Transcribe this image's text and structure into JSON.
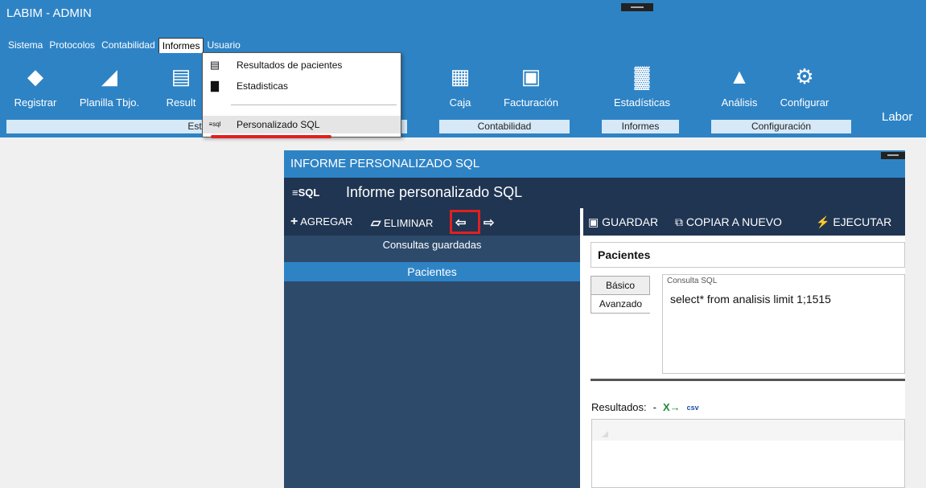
{
  "app": {
    "title": "LABIM - ADMIN",
    "right_label": "Labor"
  },
  "menu": [
    "Sistema",
    "Protocolos",
    "Contabilidad",
    "Informes",
    "Usuario"
  ],
  "toolbar": [
    {
      "label": "Registrar",
      "icon": "registrar-icon",
      "glyph": "◆"
    },
    {
      "label": "Planilla Tbjo.",
      "icon": "planilla-icon",
      "glyph": "◢"
    },
    {
      "label": "Result",
      "icon": "resultados-icon",
      "glyph": "▤"
    },
    {
      "label": "Caja",
      "icon": "caja-icon",
      "glyph": "▦"
    },
    {
      "label": "Facturación",
      "icon": "facturacion-icon",
      "glyph": "▣"
    },
    {
      "label": "Estadísticas",
      "icon": "estadisticas-icon",
      "glyph": "▓"
    },
    {
      "label": "Análisis",
      "icon": "analisis-icon",
      "glyph": "▲"
    },
    {
      "label": "Configurar",
      "icon": "configurar-icon",
      "glyph": "⚙"
    }
  ],
  "groups": [
    "Estudio -",
    "Contabilidad",
    "Informes",
    "Configuración"
  ],
  "dropdown": [
    {
      "label": "Resultados de pacientes",
      "icon": "document-icon",
      "glyph": "▤"
    },
    {
      "label": "Estadisticas",
      "icon": "bar-chart-icon",
      "glyph": "▇"
    },
    {
      "label": "Personalizado SQL",
      "icon": "sql-icon",
      "glyph": "≡sql"
    }
  ],
  "window": {
    "title": "INFORME PERSONALIZADO SQL",
    "heading_icon": "≡SQL",
    "heading": "Informe personalizado SQL",
    "left_toolbar": {
      "add": "AGREGAR",
      "delete": "ELIMINAR",
      "import_glyph": "⇦",
      "export_glyph": "⇨"
    },
    "saved_title": "Consultas guardadas",
    "saved_items": [
      "Pacientes"
    ],
    "right_toolbar": {
      "save": "GUARDAR",
      "copy": "COPIAR A NUEVO",
      "run": "EJECUTAR"
    },
    "query_name": "Pacientes",
    "tabs": [
      "Básico",
      "Avanzado"
    ],
    "sql_caption": "Consulta SQL",
    "sql_text": "select* from analisis limit 1;1515",
    "results_label": "Resultados:",
    "results_value": "-",
    "excel_glyph": "X→",
    "csv_glyph": "csv"
  },
  "colors": {
    "accent": "#2e83c5",
    "dark": "#1f3552",
    "panel": "#2e4a6b",
    "highlight": "#e02020"
  }
}
